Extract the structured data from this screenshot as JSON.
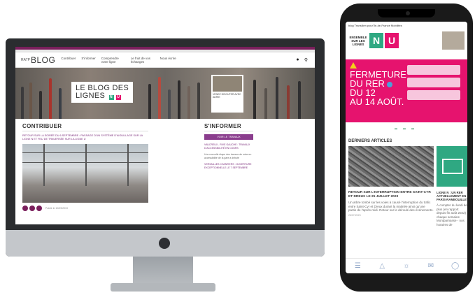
{
  "desktop": {
    "site": {
      "brand_small": "RATP",
      "blog_title": "BLOG",
      "nav": [
        "Contribuer",
        "S'informer",
        "Comprendre votre ligne",
        "Le fruit de vos échanges",
        "Nous écrire"
      ],
      "hero_title_line1": "LE BLOG DES",
      "hero_title_line2": "LIGNES",
      "hero_badge_n": "N",
      "hero_badge_u": "U",
      "hero_card_text": "VENEZ DISCUTER AVEC ADRIE",
      "contribute_heading": "CONTRIBUER",
      "contribute_lead": "RETOUR SUR LA SOIRÉE DU 6 SEPTEMBRE : PASSAGE D'UN SYSTÈME D'AIGUILLAGE SUR LA LIGNE N ET FEU DE TRAVERSÉE SUR LA LIGNE U",
      "inform_heading": "S'INFORMER",
      "inform_button": "VOIR LE TRAVAUX",
      "side_item_1": "VAUCREUX - RIVE GAUCHE : TRAVAUX D'ACCESSIBILITÉ EN COURS",
      "side_item_1_text": "Une nouvelle étape des travaux de mise en accessibilité de la gare a débuté",
      "side_item_2": "VERSAILLES CHANTIERS : OUVERTURE EXCEPTIONNELLE LE 7 SEPTEMBRE",
      "post_date": "Publié le 10/09/2019"
    }
  },
  "phone": {
    "status_text": "blog Transilien pour Île-de-France Mobilités",
    "logo_text": "ENSEMBLE SUR LES LIGNES",
    "badge_n": "N",
    "badge_u": "U",
    "promo_lines": [
      "FERMETURE",
      "DU RER",
      "DU 12",
      "AU 14 AOÛT."
    ],
    "section_title": "DERNIERS ARTICLES",
    "article_1": {
      "title": "RETOUR SUR L'INTERRUPTION ENTRE SAINT-CYR ET DREUX LE 25 JUILLET 2023",
      "excerpt": "Un arbre tombé sur les voies à causé l'interruption du trafic entre Saint-Cyr et Dreux durant la matinée ainsi qu'une partie de l'après-midi. Retour sur le déroulé des événements.",
      "date": "26/07/2023"
    },
    "article_2": {
      "title": "LIGNE N : UN RER ACTUELLEMENT EN PARIS-RAMBOUILLET",
      "excerpt": "À compter du lundi de plus (en rapport depuis fin août 2022) chaque semaine Montparnasse - nos horaires de"
    },
    "tab_icons": [
      "menu-icon",
      "alert-icon",
      "bulb-icon",
      "mail-icon",
      "chat-icon"
    ],
    "colors": {
      "magenta": "#e6136e",
      "n_green": "#2fa882",
      "u_purple": "#7a2a7a"
    }
  }
}
